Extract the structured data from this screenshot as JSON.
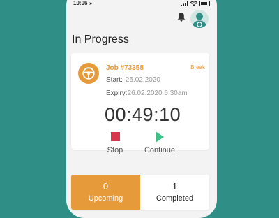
{
  "status_bar": {
    "time": "10:06",
    "location_arrow": "➤",
    "signal_icon": "signal-icon",
    "wifi_icon": "wifi-icon",
    "battery_icon": "battery-icon"
  },
  "header": {
    "notification_icon": "bell-icon",
    "avatar_icon": "driver-avatar-icon"
  },
  "page": {
    "title": "In Progress"
  },
  "job_card": {
    "icon": "steering-wheel-icon",
    "job_number": "Job #73358",
    "status_tag": "Break",
    "start_label": "Start:",
    "start_value": "25.02.2020",
    "expiry_label": "Expiry:",
    "expiry_value": "26.02.2020 6:30am",
    "timer": "00:49:10",
    "stop_label": "Stop",
    "continue_label": "Continue"
  },
  "summary": {
    "upcoming_count": "0",
    "upcoming_label": "Upcoming",
    "completed_count": "1",
    "completed_label": "Completed"
  },
  "colors": {
    "background": "#2f8f86",
    "accent": "#e69a3a",
    "stop": "#d9364c",
    "continue": "#3cbf85"
  }
}
